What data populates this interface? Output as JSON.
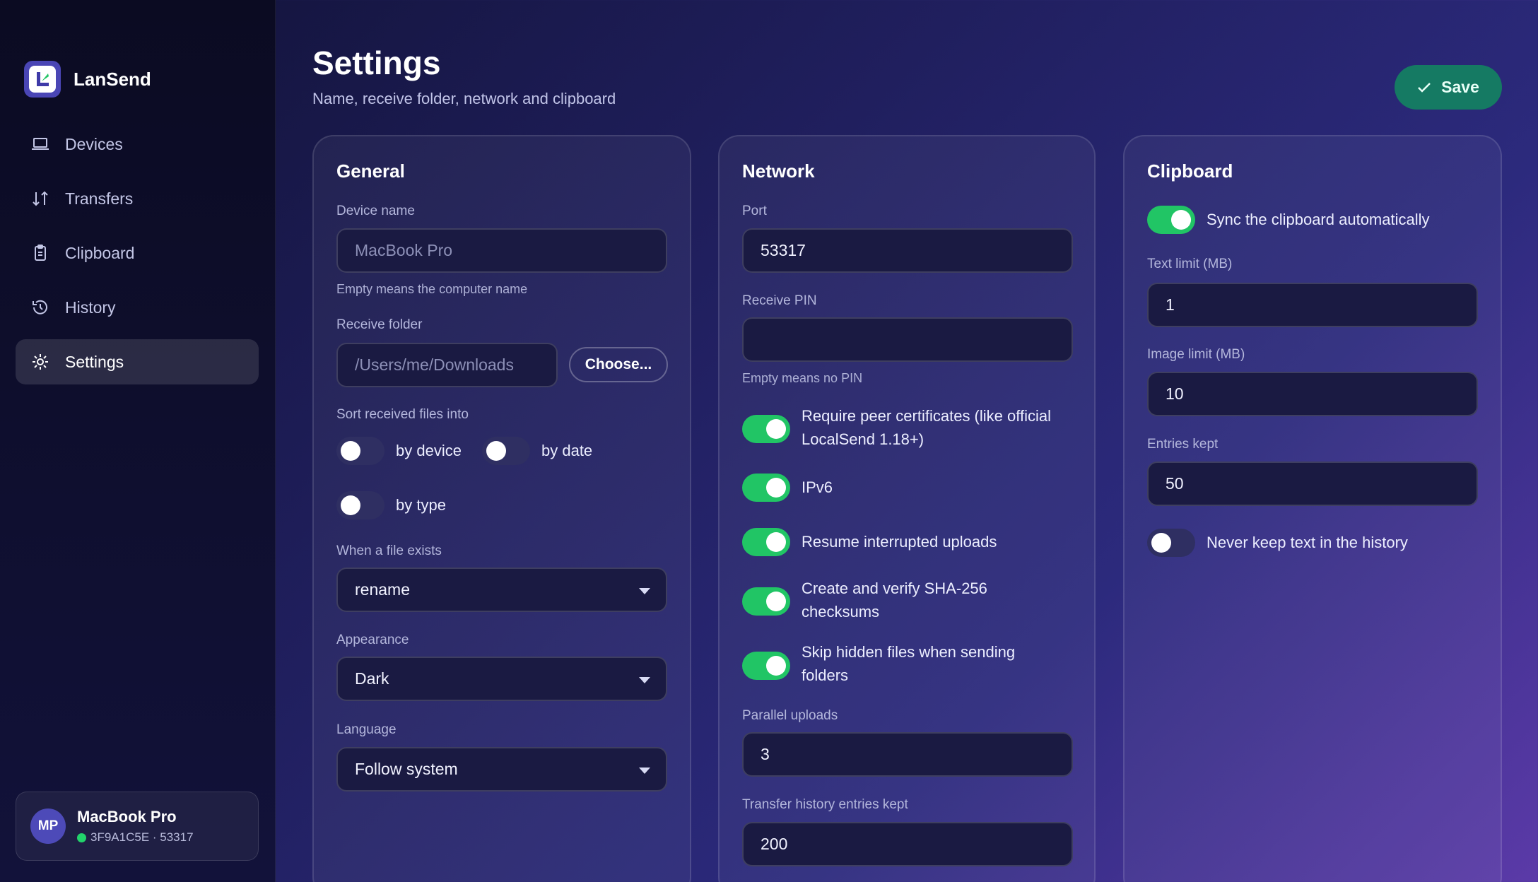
{
  "app": {
    "name": "LanSend"
  },
  "sidebar": {
    "items": [
      {
        "label": "Devices",
        "icon": "laptop-icon"
      },
      {
        "label": "Transfers",
        "icon": "transfer-arrows-icon"
      },
      {
        "label": "Clipboard",
        "icon": "clipboard-icon"
      },
      {
        "label": "History",
        "icon": "history-icon"
      },
      {
        "label": "Settings",
        "icon": "gear-icon",
        "active": true
      }
    ],
    "device": {
      "initials": "MP",
      "name": "MacBook Pro",
      "id": "3F9A1C5E · 53317",
      "status": "online"
    }
  },
  "header": {
    "title": "Settings",
    "subtitle": "Name, receive folder, network and clipboard",
    "save_label": "Save"
  },
  "general": {
    "title": "General",
    "device_name_label": "Device name",
    "device_name_placeholder": "MacBook Pro",
    "device_name_hint": "Empty means the computer name",
    "receive_folder_label": "Receive folder",
    "receive_folder_placeholder": "/Users/me/Downloads",
    "choose_label": "Choose...",
    "sort_label": "Sort received files into",
    "sort_by_device": {
      "label": "by device",
      "on": false
    },
    "sort_by_date": {
      "label": "by date",
      "on": false
    },
    "sort_by_type": {
      "label": "by type",
      "on": false
    },
    "file_exists_label": "When a file exists",
    "file_exists_value": "rename",
    "appearance_label": "Appearance",
    "appearance_value": "Dark",
    "language_label": "Language",
    "language_value": "Follow system"
  },
  "network": {
    "title": "Network",
    "port_label": "Port",
    "port_value": "53317",
    "pin_label": "Receive PIN",
    "pin_value": "",
    "pin_hint": "Empty means no PIN",
    "require_certs": {
      "label": "Require peer certificates (like official LocalSend 1.18+)",
      "on": true
    },
    "ipv6": {
      "label": "IPv6",
      "on": true
    },
    "resume": {
      "label": "Resume interrupted uploads",
      "on": true
    },
    "checksums": {
      "label": "Create and verify SHA-256 checksums",
      "on": true
    },
    "skip_hidden": {
      "label": "Skip hidden files when sending folders",
      "on": true
    },
    "parallel_label": "Parallel uploads",
    "parallel_value": "3",
    "history_label": "Transfer history entries kept",
    "history_value": "200"
  },
  "clipboard": {
    "title": "Clipboard",
    "sync": {
      "label": "Sync the clipboard automatically",
      "on": true
    },
    "text_limit_label": "Text limit (MB)",
    "text_limit_value": "1",
    "image_limit_label": "Image limit (MB)",
    "image_limit_value": "10",
    "entries_label": "Entries kept",
    "entries_value": "50",
    "never_keep": {
      "label": "Never keep text in the history",
      "on": false
    }
  },
  "colors": {
    "accent_green": "#21c565",
    "save_button": "#157a63",
    "sidebar_bg": "#0b0b22"
  }
}
